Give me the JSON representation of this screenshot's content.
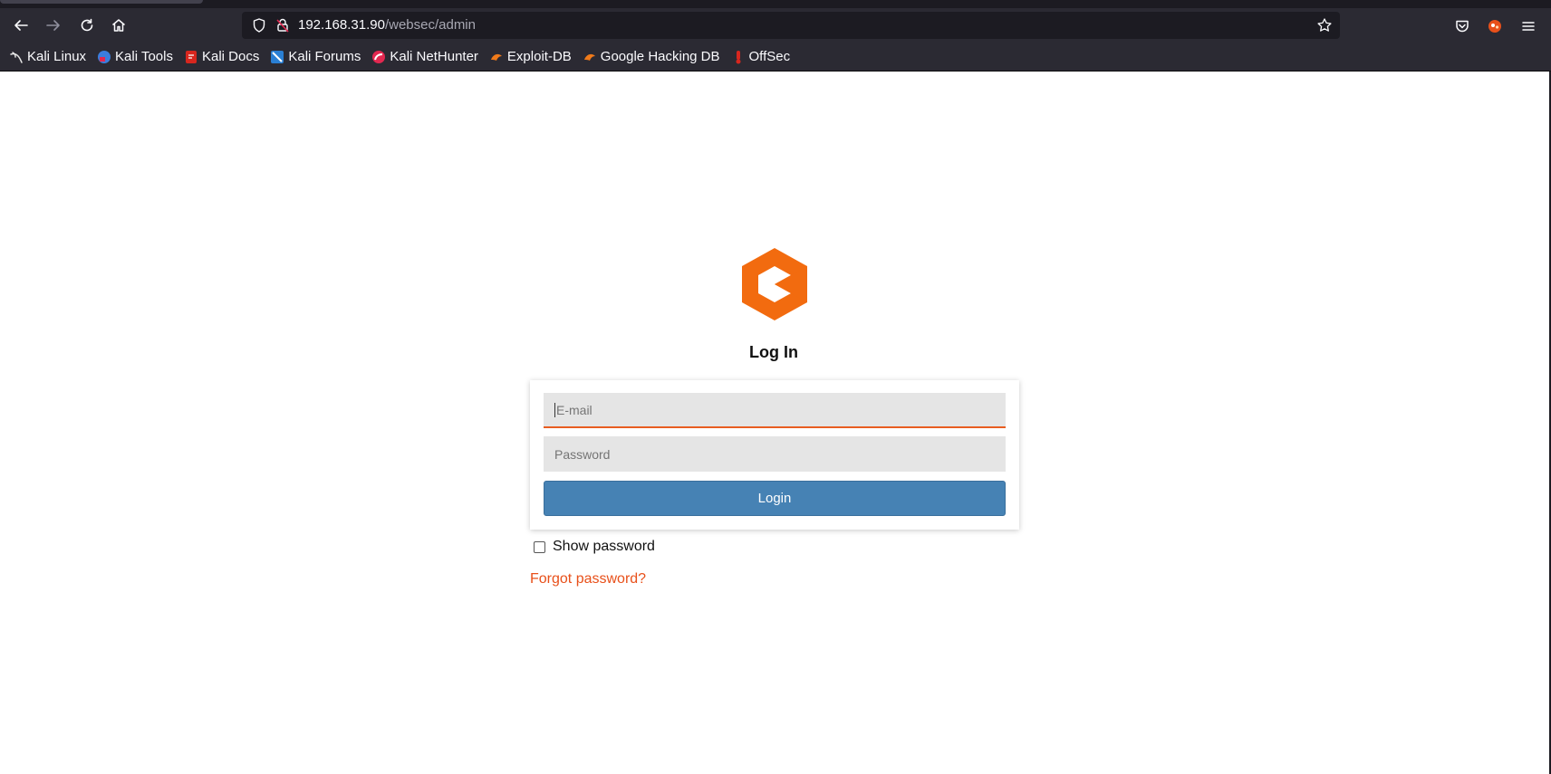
{
  "browser": {
    "url_host": "192.168.31.90",
    "url_path": "/websec/admin",
    "bookmarks": [
      {
        "label": "Kali Linux",
        "icon": "kali-dragon-icon"
      },
      {
        "label": "Kali Tools",
        "icon": "kali-tools-icon"
      },
      {
        "label": "Kali Docs",
        "icon": "kali-docs-icon"
      },
      {
        "label": "Kali Forums",
        "icon": "kali-forums-icon"
      },
      {
        "label": "Kali NetHunter",
        "icon": "kali-nethunter-icon"
      },
      {
        "label": "Exploit-DB",
        "icon": "exploit-db-icon"
      },
      {
        "label": "Google Hacking DB",
        "icon": "ghdb-icon"
      },
      {
        "label": "OffSec",
        "icon": "offsec-icon"
      }
    ]
  },
  "login": {
    "title": "Log In",
    "email_placeholder": "E-mail",
    "password_placeholder": "Password",
    "button_label": "Login",
    "show_password_label": "Show password",
    "forgot_label": "Forgot password?"
  },
  "colors": {
    "accent": "#e8501a",
    "brand_orange": "#f26b0f",
    "button": "#4682b4"
  }
}
